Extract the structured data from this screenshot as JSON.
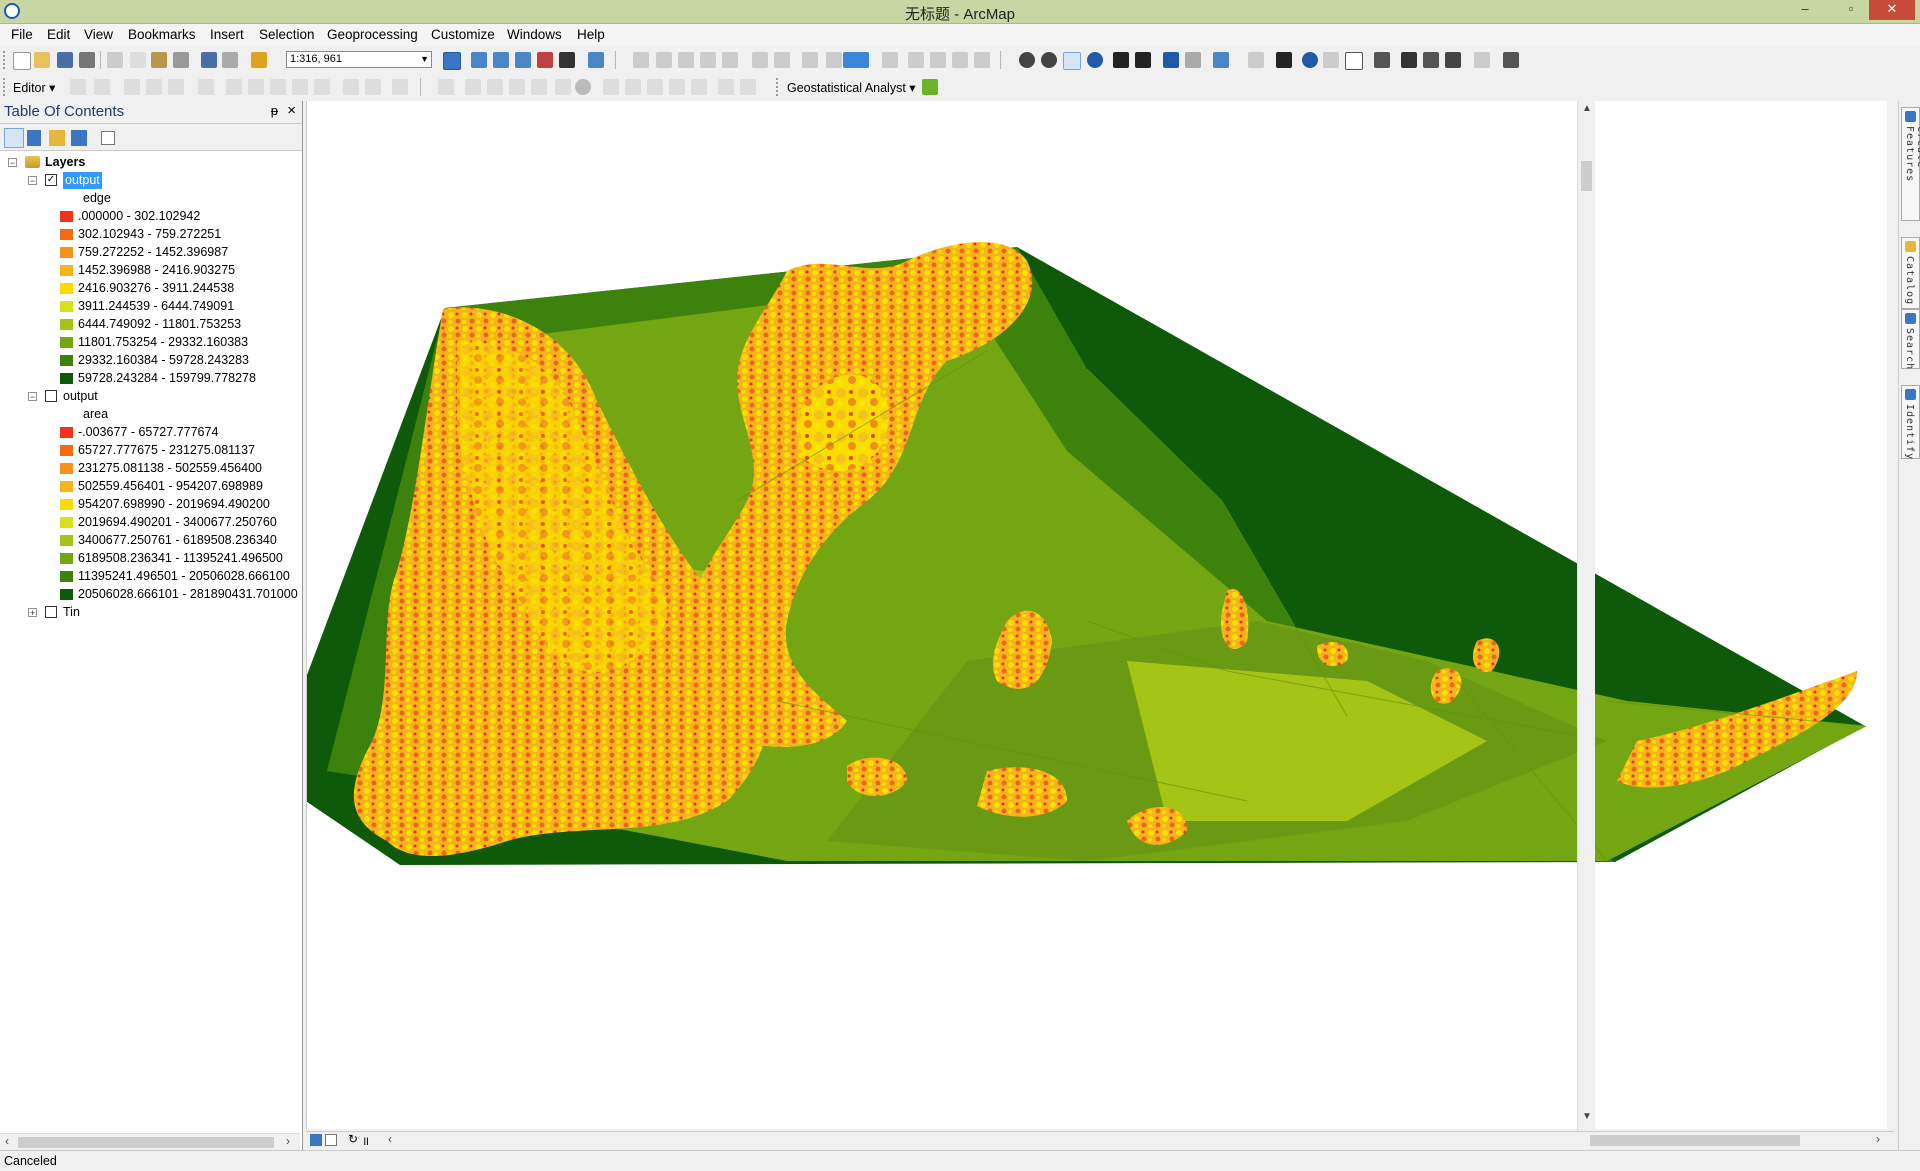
{
  "window": {
    "title": "无标题 - ArcMap",
    "minimize": "–",
    "restore": "▫",
    "close": "✕"
  },
  "menu": [
    "File",
    "Edit",
    "View",
    "Bookmarks",
    "Insert",
    "Selection",
    "Geoprocessing",
    "Customize",
    "Windows",
    "Help"
  ],
  "toolbar": {
    "scale_value": "1:316, 961",
    "editor_label": "Editor ▾",
    "geostat_label": "Geostatistical Analyst ▾"
  },
  "toc": {
    "title": "Table Of Contents",
    "pin": "ᵽ",
    "close": "×",
    "root_label": "Layers",
    "layers": [
      {
        "name": "output",
        "checked": true,
        "selected": true,
        "expanded": true,
        "field": "edge",
        "classes": [
          {
            "label": ".000000 - 302.102942",
            "color": "#f0331a"
          },
          {
            "label": "302.102943 - 759.272251",
            "color": "#f26a14"
          },
          {
            "label": "759.272252 - 1452.396987",
            "color": "#f5931d"
          },
          {
            "label": "1452.396988 - 2416.903275",
            "color": "#f7b51c"
          },
          {
            "label": "2416.903276 - 3911.244538",
            "color": "#fadc00"
          },
          {
            "label": "3911.244539 - 6444.749091",
            "color": "#d8e21c"
          },
          {
            "label": "6444.749092 - 11801.753253",
            "color": "#a6c415"
          },
          {
            "label": "11801.753254 - 29332.160383",
            "color": "#74a512"
          },
          {
            "label": "29332.160384 - 59728.243283",
            "color": "#3e820e"
          },
          {
            "label": "59728.243284 - 159799.778278",
            "color": "#0f5a0a"
          }
        ]
      },
      {
        "name": "output",
        "checked": false,
        "selected": false,
        "expanded": true,
        "field": "area",
        "classes": [
          {
            "label": "-.003677 - 65727.777674",
            "color": "#f0331a"
          },
          {
            "label": "65727.777675 - 231275.081137",
            "color": "#f26a14"
          },
          {
            "label": "231275.081138 - 502559.456400",
            "color": "#f5931d"
          },
          {
            "label": "502559.456401 - 954207.698989",
            "color": "#f7b51c"
          },
          {
            "label": "954207.698990 - 2019694.490200",
            "color": "#fadc00"
          },
          {
            "label": "2019694.490201 - 3400677.250760",
            "color": "#d8e21c"
          },
          {
            "label": "3400677.250761 - 6189508.236340",
            "color": "#a6c415"
          },
          {
            "label": "6189508.236341 - 11395241.496500",
            "color": "#74a512"
          },
          {
            "label": "11395241.496501 - 20506028.666100",
            "color": "#3e820e"
          },
          {
            "label": "20506028.666101 - 281890431.701000",
            "color": "#0f5a0a"
          }
        ]
      },
      {
        "name": "Tin",
        "checked": false,
        "selected": false,
        "expanded": false
      }
    ]
  },
  "dock_tabs": [
    "Create Features",
    "Catalog",
    "Search",
    "Identify"
  ],
  "status": {
    "text": "Canceled"
  }
}
